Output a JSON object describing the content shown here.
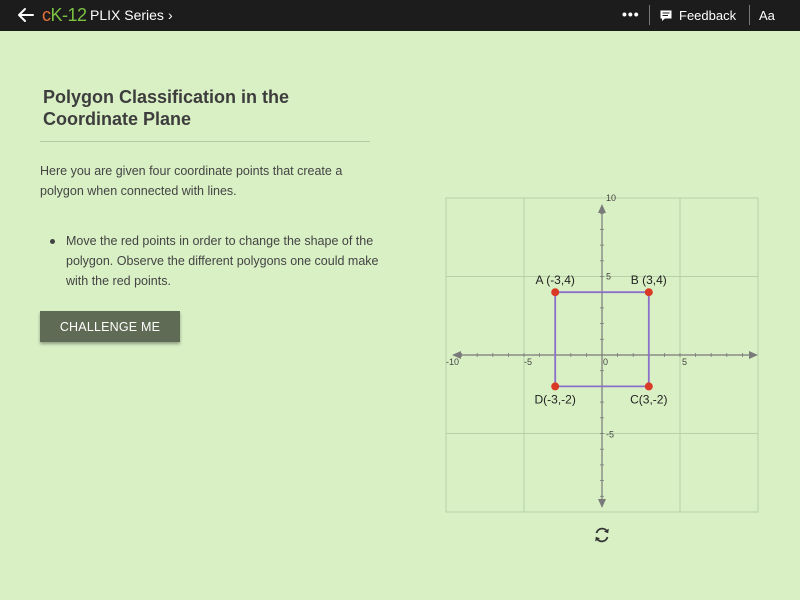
{
  "colors": {
    "background": "#d9f0c5",
    "topbar": "#1c1c1c",
    "logo_c": "#e5703a",
    "logo_k": "#7cc242",
    "polygon_edge": "#8a70c9",
    "point": "#d93a26",
    "button": "#5f6b55"
  },
  "topbar": {
    "back_icon": "arrow-left-icon",
    "logo_c": "c",
    "logo_k12": "K-12",
    "series_label": "PLIX Series",
    "series_chevron": "›",
    "more_label": "•••",
    "feedback_label": "Feedback",
    "text_size_label": "Aa"
  },
  "content": {
    "title": "Polygon Classification in the Coordinate Plane",
    "intro": "Here you are given four coordinate points that create a polygon when connected with lines.",
    "bullets": [
      "Move the red points in order to change the shape of the polygon. Observe the different polygons one could make with the red points."
    ],
    "challenge_label": "CHALLENGE ME"
  },
  "graph": {
    "x_range": [
      -10,
      10
    ],
    "y_range": [
      -10,
      10
    ],
    "grid_step": 5,
    "tick_labels": {
      "x": [
        "-10",
        "-5",
        "0",
        "5"
      ],
      "y": [
        "10",
        "5",
        "-5"
      ]
    },
    "points": [
      {
        "name": "A",
        "label": "A (-3,4)",
        "x": -3,
        "y": 4
      },
      {
        "name": "B",
        "label": "B (3,4)",
        "x": 3,
        "y": 4
      },
      {
        "name": "C",
        "label": "C(3,-2)",
        "x": 3,
        "y": -2
      },
      {
        "name": "D",
        "label": "D(-3,-2)",
        "x": -3,
        "y": -2
      }
    ],
    "refresh_icon": "refresh-icon"
  }
}
